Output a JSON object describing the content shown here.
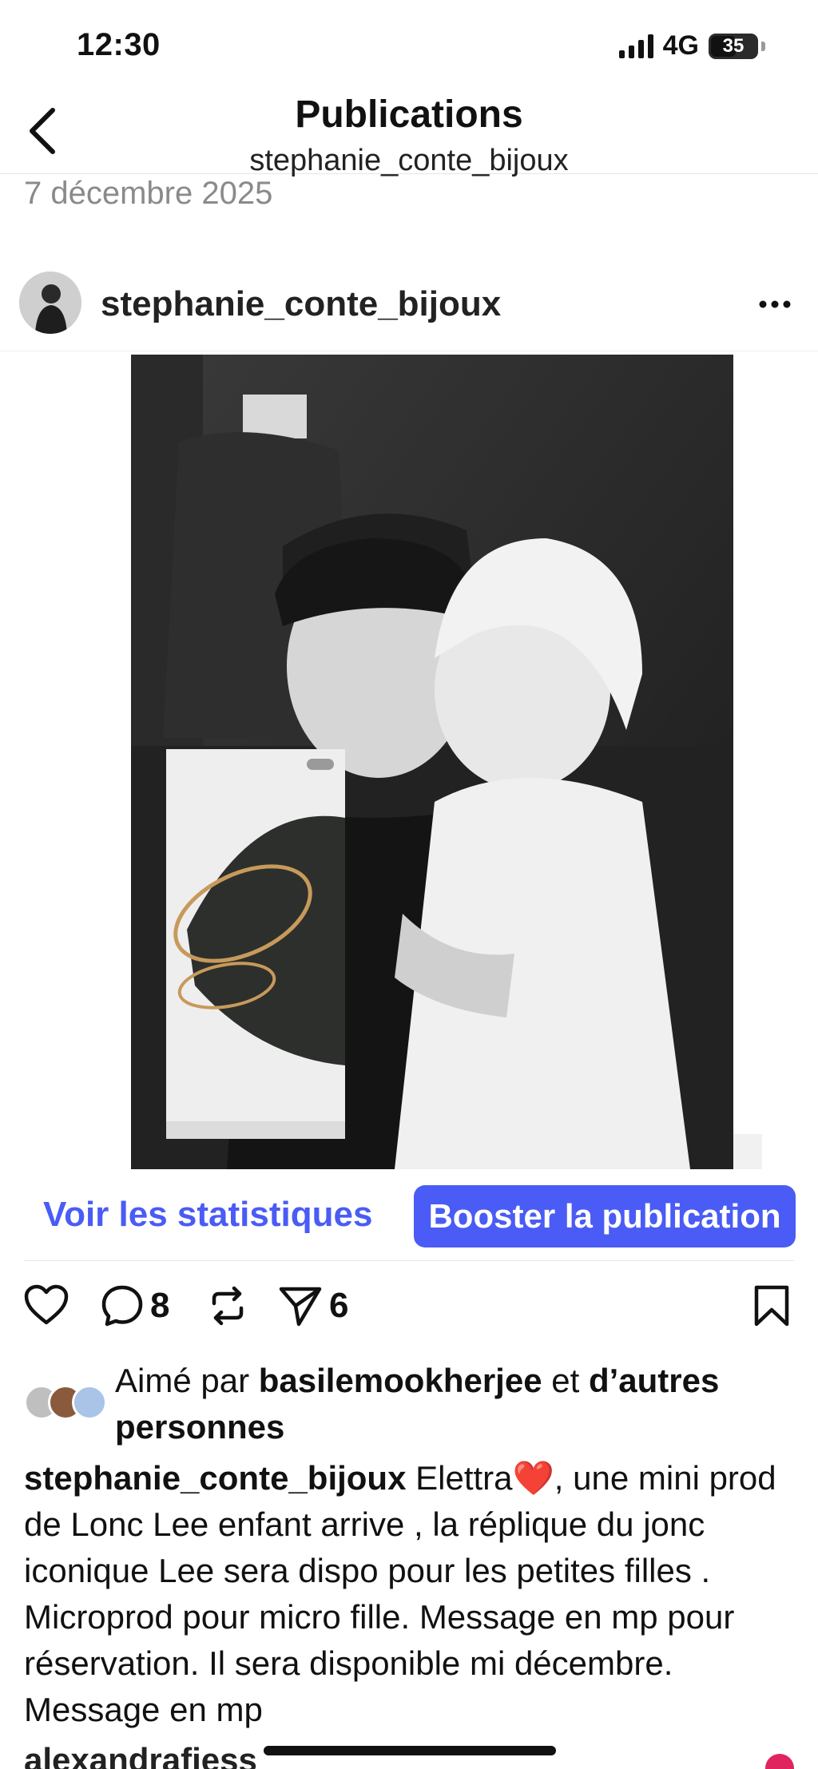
{
  "status_bar": {
    "time": "12:30",
    "network": "4G",
    "battery": "35"
  },
  "header": {
    "title": "Publications",
    "subtitle": "stephanie_conte_bijoux"
  },
  "post": {
    "date": "7 décembre 2025",
    "author": "stephanie_conte_bijoux",
    "stats_label": "Voir les statistiques",
    "boost_label": "Booster la publication",
    "comments_count": "8",
    "shares_count": "6",
    "likes": {
      "prefix": "Aimé par",
      "user": "basilemookherjee",
      "connector": "et",
      "others": "d’autres personnes"
    },
    "caption_user": "stephanie_conte_bijoux",
    "caption_text": "Elettra❤️, une mini prod de Lonc Lee enfant arrive , la réplique du jonc iconique Lee sera dispo pour les petites filles . Microprod pour micro fille. Message en mp pour réservation. Il sera disponible mi décembre. Message en mp",
    "next_comment_user": "alexandrafiess"
  },
  "colors": {
    "accent": "#4a5cf5",
    "like": "#e0245e"
  }
}
